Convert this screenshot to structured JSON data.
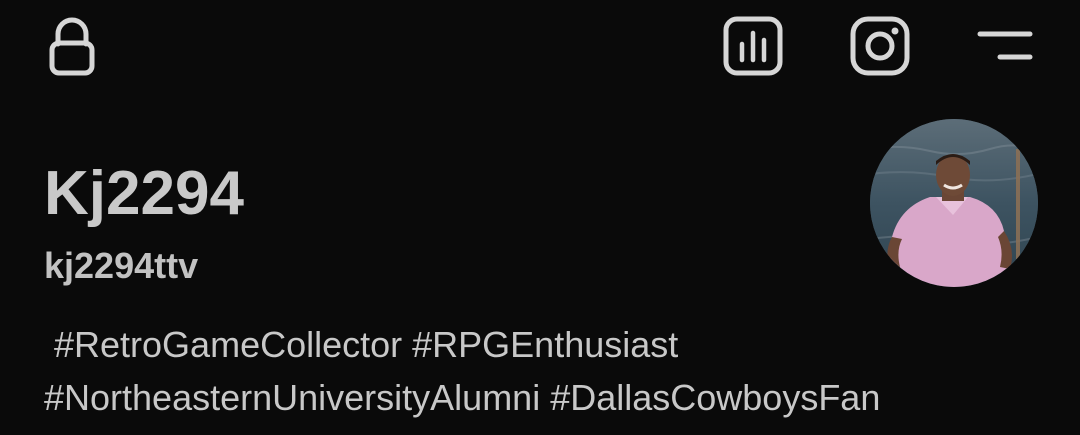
{
  "header": {
    "icons": [
      "lock-icon",
      "insights-icon",
      "instagram-icon",
      "menu-icon"
    ]
  },
  "profile": {
    "display_name": "Kj2294",
    "username": "kj2294ttv",
    "bio_lines": [
      " #RetroGameCollector #RPGEnthusiast",
      "#NortheasternUniversityAlumni #DallasCowboysFan"
    ]
  },
  "colors": {
    "background": "#0a0a0a",
    "text": "#c9c9c9",
    "icon": "#d6d6d6",
    "avatar_shirt": "#d9a7c9"
  }
}
